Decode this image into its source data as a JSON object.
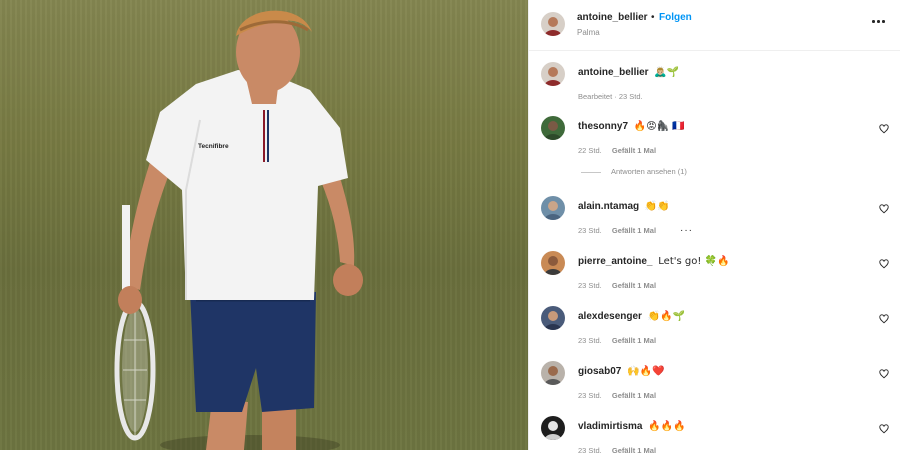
{
  "post": {
    "username": "antoine_bellier",
    "follow_label": "Folgen",
    "location": "Palma",
    "shirt_brand": "Tecnifibre"
  },
  "caption": {
    "username": "antoine_bellier",
    "emoji": "🙇🏼‍♂️🌱",
    "meta": "Bearbeitet · 23 Std."
  },
  "comments": [
    {
      "username": "thesonny7",
      "text": "🔥😡🦍 🇫🇷",
      "time": "22 Std.",
      "likes": "Gefällt 1 Mal"
    },
    {
      "username": "alain.ntamag",
      "text": "👏👏",
      "time": "23 Std.",
      "likes": "Gefällt 1 Mal"
    },
    {
      "username": "pierre_antoine_",
      "text": "Let's go! 🍀🔥",
      "time": "23 Std.",
      "likes": "Gefällt 1 Mal"
    },
    {
      "username": "alexdesenger",
      "text": "👏🔥🌱",
      "time": "23 Std.",
      "likes": "Gefällt 1 Mal"
    },
    {
      "username": "giosab07",
      "text": "🙌🔥❤️",
      "time": "23 Std.",
      "likes": "Gefällt 1 Mal"
    },
    {
      "username": "vladimirtisma",
      "text": "🔥🔥🔥",
      "time": "23 Std.",
      "likes": "Gefällt 1 Mal"
    }
  ],
  "view_replies_label": "Antworten ansehen (1)",
  "colors": {
    "link": "#0095f6",
    "meta": "#8e8e8e",
    "text": "#262626",
    "grass": "#7d8046"
  }
}
